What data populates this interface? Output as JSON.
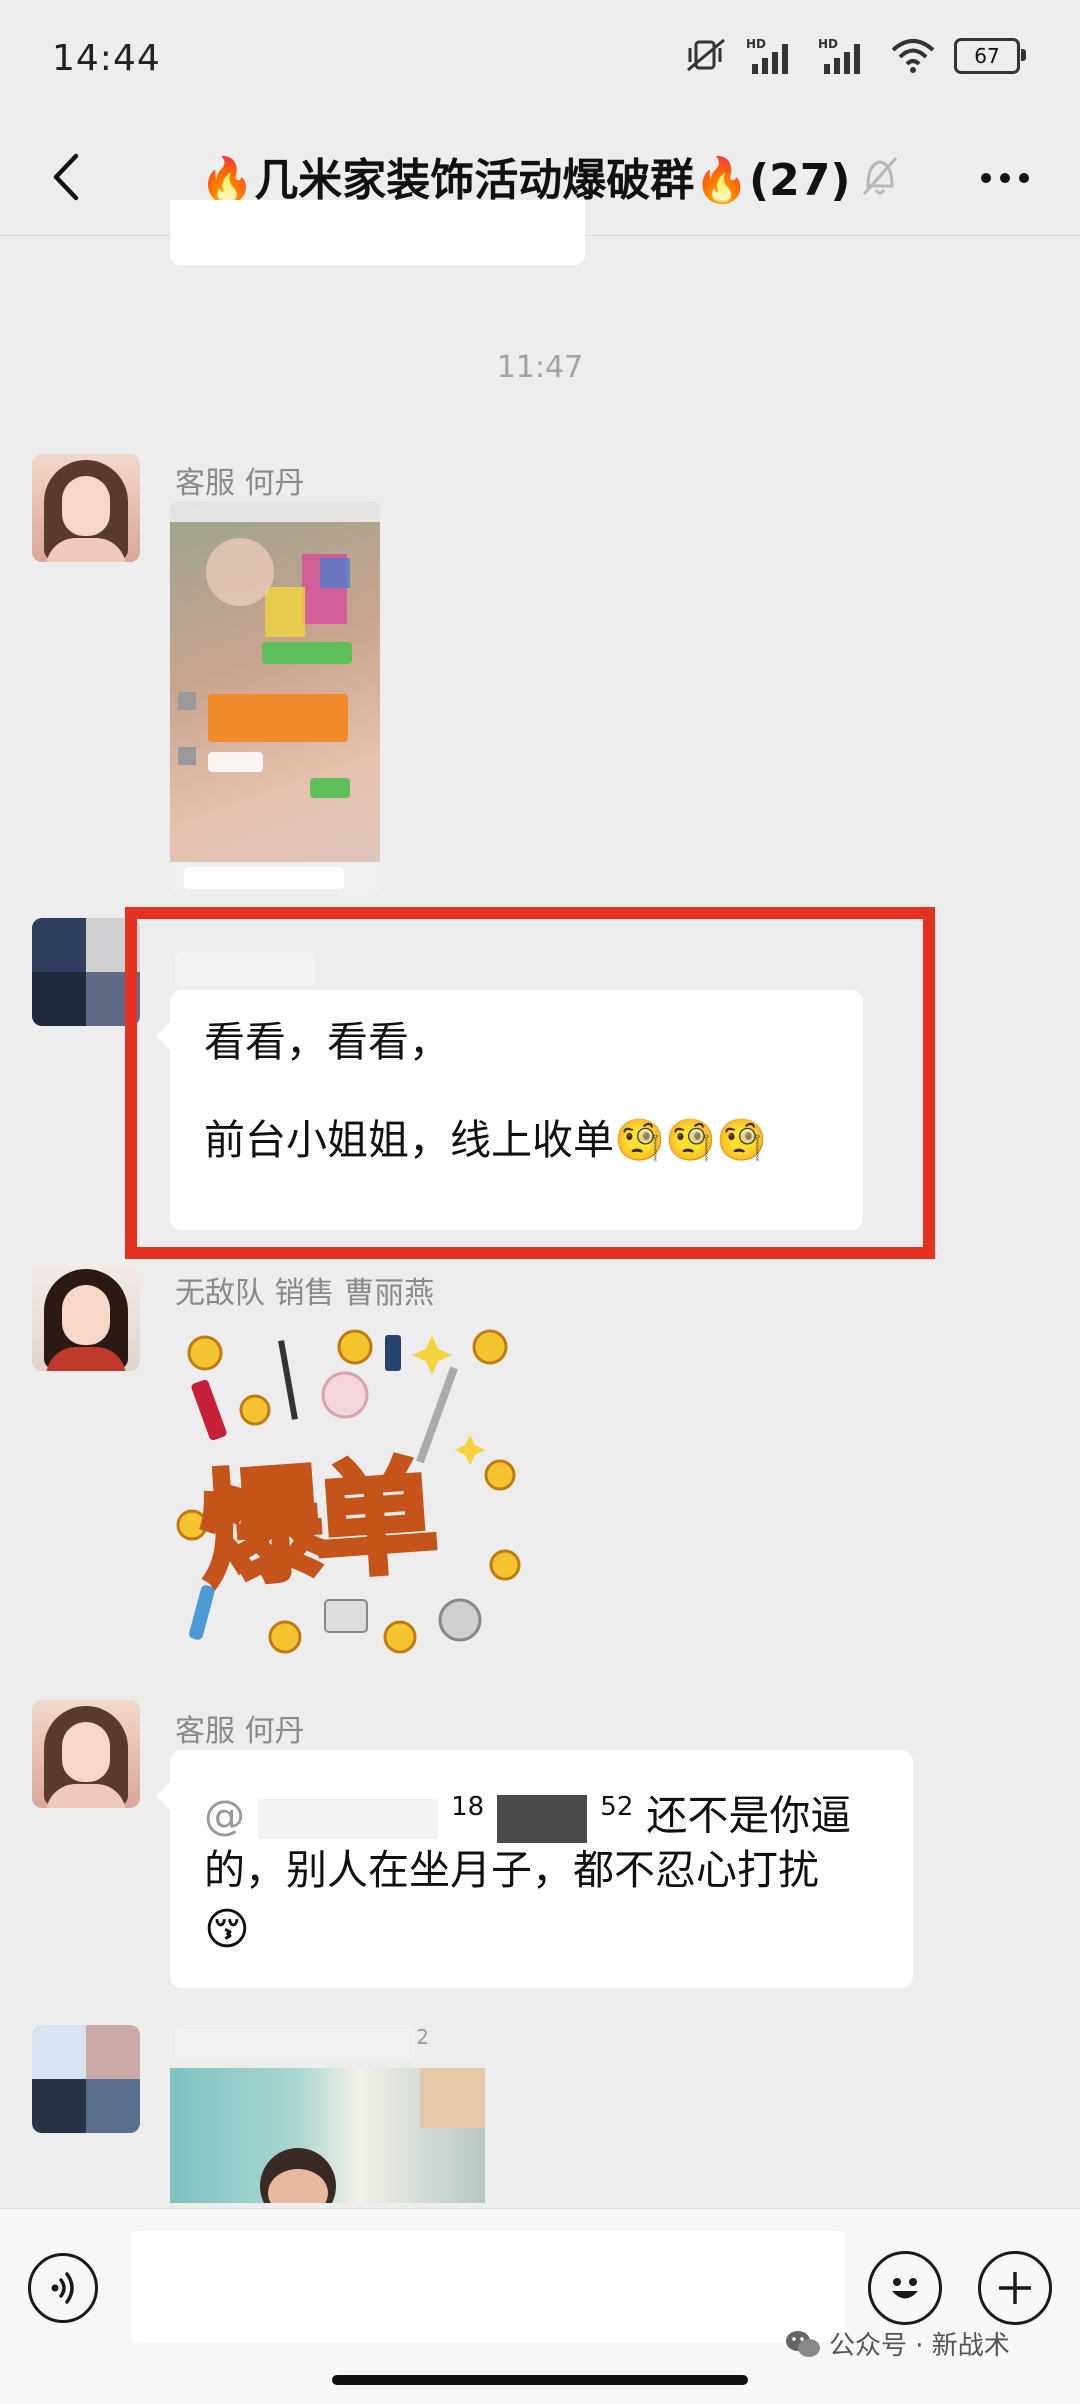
{
  "status_bar": {
    "time": "14:44",
    "battery": "67",
    "icons": [
      "mute-vibrate-icon",
      "hd-signal-icon",
      "hd-signal-icon",
      "wifi-icon",
      "battery-icon"
    ]
  },
  "header": {
    "title": "🔥几米家装饰活动爆破群🔥(27)",
    "icons": [
      "back-icon",
      "mute-icon",
      "more-icon"
    ]
  },
  "chat": {
    "timestamp": "11:47",
    "messages": [
      {
        "sender": "客服 何丹",
        "type": "image"
      },
      {
        "sender": "",
        "type": "text",
        "lines": [
          "看看，看看，",
          "前台小姐姐，线上收单🧐🧐🧐"
        ]
      },
      {
        "sender": "无敌队 销售 曹丽燕",
        "type": "sticker",
        "sticker_text": "爆单"
      },
      {
        "sender": "客服 何丹",
        "type": "text",
        "lines": [
          "@ 18 52 还不是你逼",
          "的，别人在坐月子，都不忍心打扰",
          "😚"
        ],
        "mention_prefix": "@",
        "mention_mid": "18",
        "mention_suffix": "52"
      },
      {
        "sender": "2",
        "type": "image"
      }
    ]
  },
  "input_bar": {
    "icons": [
      "voice-icon",
      "emoji-icon",
      "plus-icon"
    ],
    "watermark": "公众号 · 新战术"
  },
  "colors": {
    "background": "#ededed",
    "highlight": "#e5311f",
    "bubble": "#ffffff"
  }
}
